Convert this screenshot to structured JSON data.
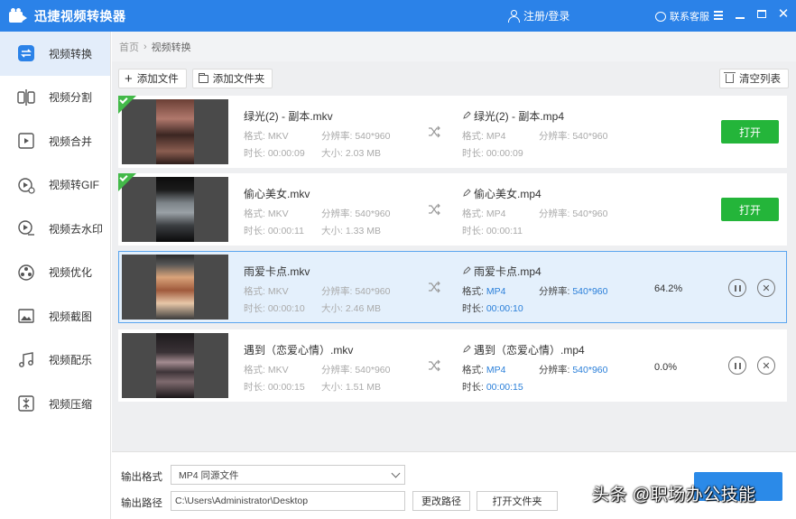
{
  "app": {
    "title": "迅捷视频转换器",
    "login": "注册/登录",
    "service": "联系客服"
  },
  "sidebar": {
    "items": [
      {
        "label": "视频转换",
        "icon": "convert-icon",
        "active": true
      },
      {
        "label": "视频分割",
        "icon": "split-icon"
      },
      {
        "label": "视频合并",
        "icon": "merge-icon"
      },
      {
        "label": "视频转GIF",
        "icon": "gif-icon"
      },
      {
        "label": "视频去水印",
        "icon": "watermark-remove-icon"
      },
      {
        "label": "视频优化",
        "icon": "optimize-icon"
      },
      {
        "label": "视频截图",
        "icon": "screenshot-icon"
      },
      {
        "label": "视频配乐",
        "icon": "music-icon"
      },
      {
        "label": "视频压缩",
        "icon": "compress-icon"
      }
    ]
  },
  "breadcrumb": {
    "home": "首页",
    "current": "视频转换"
  },
  "toolbar": {
    "add_file": "添加文件",
    "add_folder": "添加文件夹",
    "clear": "清空列表"
  },
  "labels": {
    "format": "格式:",
    "resolution": "分辨率:",
    "duration": "时长:",
    "size": "大小:",
    "open": "打开"
  },
  "files": [
    {
      "name": "绿光(2) - 副本.mkv",
      "format": "MKV",
      "resolution": "540*960",
      "duration": "00:00:09",
      "size": "2.03 MB",
      "out_name": "绿光(2) - 副本.mp4",
      "out_format": "MP4",
      "out_resolution": "540*960",
      "out_duration": "00:00:09",
      "status": "done"
    },
    {
      "name": "偷心美女.mkv",
      "format": "MKV",
      "resolution": "540*960",
      "duration": "00:00:11",
      "size": "1.33 MB",
      "out_name": "偷心美女.mp4",
      "out_format": "MP4",
      "out_resolution": "540*960",
      "out_duration": "00:00:11",
      "status": "done"
    },
    {
      "name": "雨爱卡点.mkv",
      "format": "MKV",
      "resolution": "540*960",
      "duration": "00:00:10",
      "size": "2.46 MB",
      "out_name": "雨爱卡点.mp4",
      "out_format": "MP4",
      "out_resolution": "540*960",
      "out_duration": "00:00:10",
      "status": "converting",
      "progress": "64.2%"
    },
    {
      "name": "遇到（恋爱心情）.mkv",
      "format": "MKV",
      "resolution": "540*960",
      "duration": "00:00:15",
      "size": "1.51 MB",
      "out_name": "遇到（恋爱心情）.mp4",
      "out_format": "MP4",
      "out_resolution": "540*960",
      "out_duration": "00:00:15",
      "status": "waiting",
      "progress": "0.0%"
    }
  ],
  "output": {
    "format_label": "输出格式",
    "format_value": "MP4  同源文件",
    "path_label": "输出路径",
    "path_value": "C:\\Users\\Administrator\\Desktop",
    "change_path": "更改路径",
    "open_folder": "打开文件夹"
  },
  "watermark": "头条 @职场办公技能"
}
